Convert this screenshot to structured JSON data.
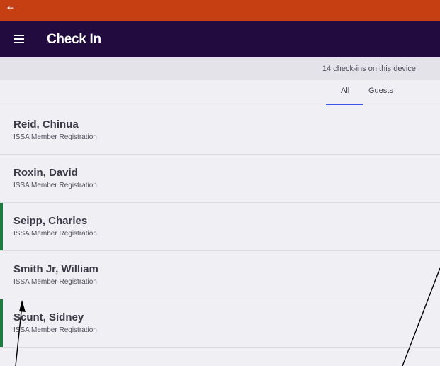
{
  "status_bar": {
    "back_icon": "←"
  },
  "app_bar": {
    "title": "Check In",
    "menu_icon": "hamburger-menu-icon"
  },
  "checkin_count": "14 check-ins on this device",
  "tabs": [
    {
      "label": "All",
      "active": true
    },
    {
      "label": "Guests",
      "active": false
    }
  ],
  "attendees": [
    {
      "name": "Reid, Chinua",
      "ticket": "ISSA Member Registration",
      "checked_in": false
    },
    {
      "name": "Roxin, David",
      "ticket": "ISSA Member Registration",
      "checked_in": false
    },
    {
      "name": "Seipp, Charles",
      "ticket": "ISSA Member Registration",
      "checked_in": true
    },
    {
      "name": "Smith Jr, William",
      "ticket": "ISSA Member Registration",
      "checked_in": false
    },
    {
      "name": "Scunt, Sidney",
      "ticket": "ISSA Member Registration",
      "checked_in": true
    }
  ],
  "colors": {
    "status_bar": "#c63f12",
    "app_bar": "#220c3f",
    "checked_in_accent": "#1f7a3f",
    "tab_underline": "#3659e3"
  }
}
